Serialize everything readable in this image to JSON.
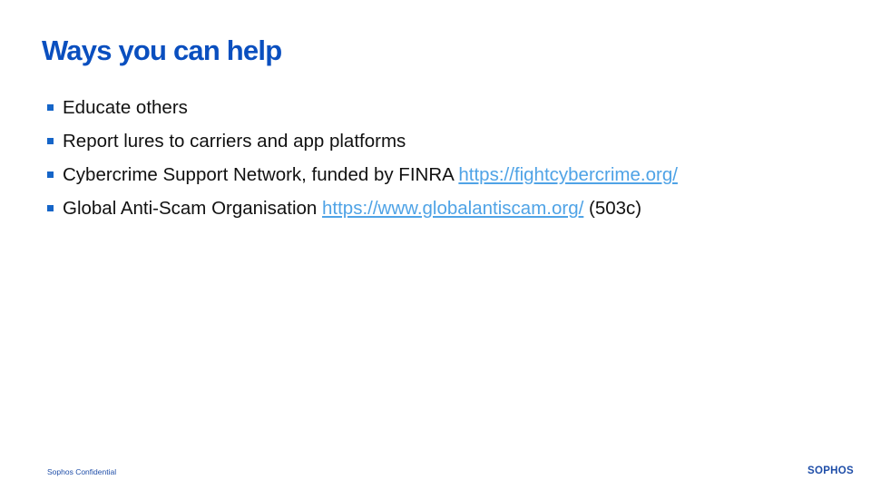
{
  "slide": {
    "title": "Ways you can help",
    "bullets": [
      {
        "text": "Educate others"
      },
      {
        "text": "Report lures to carriers and app platforms"
      },
      {
        "text": "Cybercrime Support Network, funded by FINRA",
        "link": "https://fightcybercrime.org/"
      },
      {
        "text": "Global Anti-Scam Organisation",
        "link": "https://www.globalantiscam.org/",
        "suffix": "(503c)"
      }
    ]
  },
  "footer": {
    "confidential": "Sophos Confidential",
    "logo_text": "SOPHOS"
  },
  "colors": {
    "title": "#0a4fbf",
    "bullet_marker": "#1565c8",
    "link": "#4fa3e6",
    "footer": "#1f4ea8"
  }
}
